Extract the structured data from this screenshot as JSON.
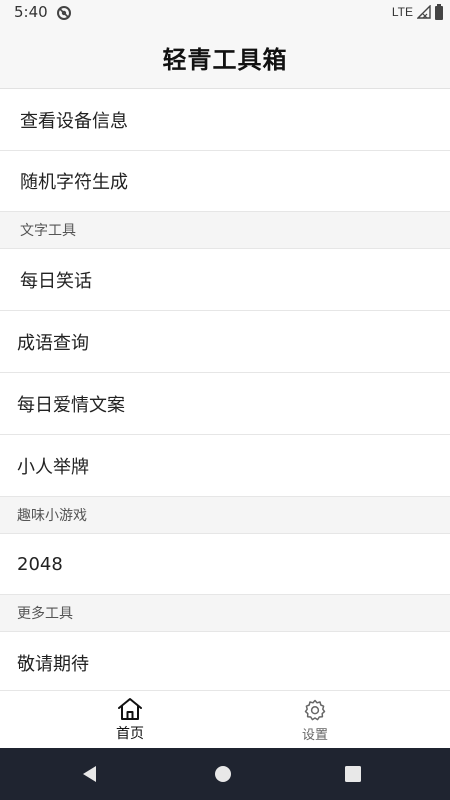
{
  "status_bar": {
    "time": "5:40",
    "network": "LTE"
  },
  "app": {
    "title": "轻青工具箱"
  },
  "sections": {
    "top_items": [
      "查看设备信息",
      "随机字符生成"
    ],
    "text_tools": {
      "header": "文字工具",
      "items": [
        "每日笑话",
        "成语查询",
        "每日爱情文案",
        "小人举牌"
      ]
    },
    "fun_games": {
      "header": "趣味小游戏",
      "items": [
        "2048"
      ]
    },
    "more_tools": {
      "header": "更多工具",
      "items": [
        "敬请期待"
      ]
    }
  },
  "bottom_nav": {
    "home_label": "首页",
    "settings_label": "设置",
    "active": "home"
  },
  "colors": {
    "system_bar": "#1f2430",
    "background": "#f7f7f7",
    "divider": "#e6e6e6"
  }
}
